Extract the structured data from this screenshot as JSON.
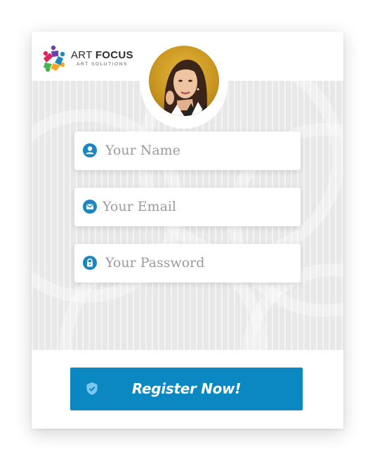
{
  "brand": {
    "name_prefix": "ART ",
    "name_bold": "FOCUS",
    "tagline": "ART SOLUTIONS"
  },
  "form": {
    "name": {
      "placeholder": "Your Name",
      "value": "",
      "icon": "user-icon"
    },
    "email": {
      "placeholder": "Your Email",
      "value": "",
      "icon": "envelope-icon"
    },
    "password": {
      "placeholder": "Your Password",
      "value": "",
      "icon": "lock-icon"
    }
  },
  "submit": {
    "label": "Register Now!",
    "icon": "shield-check-icon"
  },
  "colors": {
    "accent": "#0b88c2",
    "icon": "#1a87bf",
    "background": "#e8e8e8"
  }
}
